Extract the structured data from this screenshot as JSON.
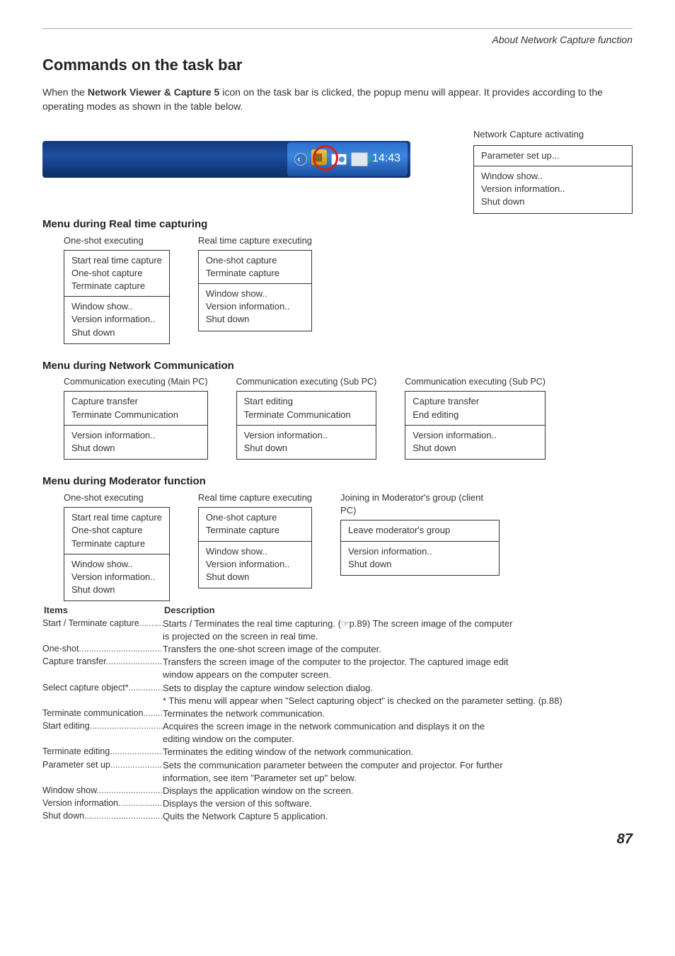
{
  "page": {
    "section": "About Network Capture function",
    "heading": "Commands on the task bar",
    "intro_pre": "When the ",
    "intro_bold": "Network Viewer & Capture 5",
    "intro_post": " icon on the task bar is clicked, the popup menu will appear. It provides according to the operating modes as shown in the table below.",
    "page_number": "87"
  },
  "taskbar": {
    "time": "14:43"
  },
  "activating": {
    "label": "Network Capture activating",
    "menu1": [
      "Parameter set up..."
    ],
    "menu2": [
      "Window show..",
      "Version information..",
      "Shut down"
    ]
  },
  "realtime": {
    "heading": "Menu during Real time capturing",
    "col1_label": "One-shot executing",
    "col1_m1": [
      "Start real time capture",
      "One-shot capture",
      "Terminate capture"
    ],
    "col1_m2": [
      "Window show..",
      "Version information..",
      "Shut down"
    ],
    "col2_label": "Real time capture executing",
    "col2_m1": [
      "One-shot capture",
      "Terminate capture"
    ],
    "col2_m2": [
      "Window show..",
      "Version information..",
      "Shut down"
    ]
  },
  "netcom": {
    "heading": "Menu during Network Communication",
    "col1_label": "Communication executing (Main PC)",
    "col1_m1": [
      "Capture transfer",
      "Terminate Communication"
    ],
    "col1_m2": [
      "Version information..",
      "Shut down"
    ],
    "col2_label": "Communication executing (Sub PC)",
    "col2_m1": [
      "Start editing",
      "Terminate Communication"
    ],
    "col2_m2": [
      "Version information..",
      "Shut down"
    ],
    "col3_label": "Communication executing (Sub PC)",
    "col3_m1": [
      "Capture transfer",
      "End editing"
    ],
    "col3_m2": [
      "Version information..",
      "Shut down"
    ]
  },
  "moderator": {
    "heading": "Menu during Moderator function",
    "col1_label": "One-shot executing",
    "col1_m1": [
      "Start real time capture",
      "One-shot capture",
      "Terminate capture"
    ],
    "col1_m2": [
      "Window show..",
      "Version information..",
      "Shut down"
    ],
    "col2_label": "Real time capture executing",
    "col2_m1": [
      "One-shot capture",
      "Terminate capture"
    ],
    "col2_m2": [
      "Window show..",
      "Version information..",
      "Shut down"
    ],
    "col3_label": "Joining in Moderator's group (client PC)",
    "col3_m1": [
      "Leave moderator's group"
    ],
    "col3_m2": [
      "Version information..",
      "Shut down"
    ]
  },
  "table": {
    "head_items": "Items",
    "head_desc": "Description",
    "rows": [
      {
        "t": "Start  / Terminate capture",
        "dots": "..................",
        "d": "Starts / Terminates the real time capturing. (☞p.89) The screen image of the computer",
        "cont": "is projected on the screen in real time."
      },
      {
        "t": "One-shot",
        "dots": "...........................................",
        "d": "Transfers the one-shot screen image of the computer."
      },
      {
        "t": "Capture transfer",
        "dots": ".................................",
        "d": "Transfers the screen image of the computer to the projector. The captured image edit",
        "cont": "window appears on the computer screen."
      },
      {
        "t": "Select capture object*",
        "dots": "..........................",
        "d": "Sets to display the capture window selection dialog.",
        "cont": "* This menu will appear when \"Select capturing object\" is checked on the parameter setting. (p.88)"
      },
      {
        "t": "Terminate communication",
        "dots": "..................",
        "d": "Terminates the network communication."
      },
      {
        "t": "Start editing",
        "dots": ".....................................",
        "d": "Acquires the screen image in the network communication and displays it on the",
        "cont": "editing window on the computer."
      },
      {
        "t": "Terminate editing",
        "dots": "..............................",
        "d": "Terminates the editing window of the network communication."
      },
      {
        "t": "Parameter set up",
        "dots": "...............................",
        "d": "Sets the communication parameter between the computer and projector. For further",
        "cont": "information, see item \"Parameter set up\" below."
      },
      {
        "t": "Window show",
        "dots": "....................................",
        "d": "Displays the application window on the screen."
      },
      {
        "t": "Version information",
        "dots": "............................",
        "d": "Displays the version of this software."
      },
      {
        "t": "Shut down",
        "dots": "..........................................",
        "d": "Quits the Network Capture 5 application."
      }
    ]
  }
}
